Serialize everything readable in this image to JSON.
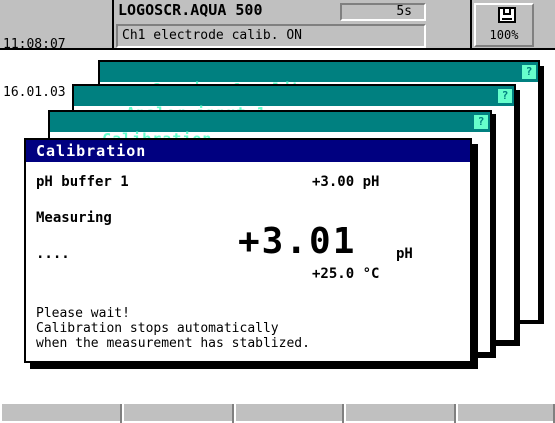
{
  "header": {
    "time": "11:08:07",
    "date": "16.01.03",
    "device_title": "LOGOSCR.AQUA 500",
    "interval": "5s",
    "status_message": "Ch1 electrode calib. ON",
    "memory_icon": "floppy-disk-icon",
    "memory_percent": "100%"
  },
  "windows": {
    "service": {
      "title": "Service & calib."
    },
    "analog": {
      "title": "Analog input 1"
    },
    "calibration_back": {
      "title": "Calibration"
    },
    "help_icon_glyph": "?"
  },
  "calibration": {
    "title": "Calibration",
    "buffer_label": "pH buffer 1",
    "buffer_value": "+3.00 pH",
    "measuring_label": "Measuring",
    "progress_dots": "....",
    "measured_value": "+3.01",
    "measured_unit": "pH",
    "temperature": "+25.0 °C",
    "message_line1": "Please wait!",
    "message_line2": "Calibration stops automatically",
    "message_line3": "when the measurement has stablized."
  },
  "softkeys": [
    "",
    "",
    "",
    "",
    ""
  ],
  "colors": {
    "window_title_teal": "#008080",
    "window_title_text": "#66ffcc",
    "active_title_navy": "#000080",
    "chrome_gray": "#c0c0c0"
  }
}
